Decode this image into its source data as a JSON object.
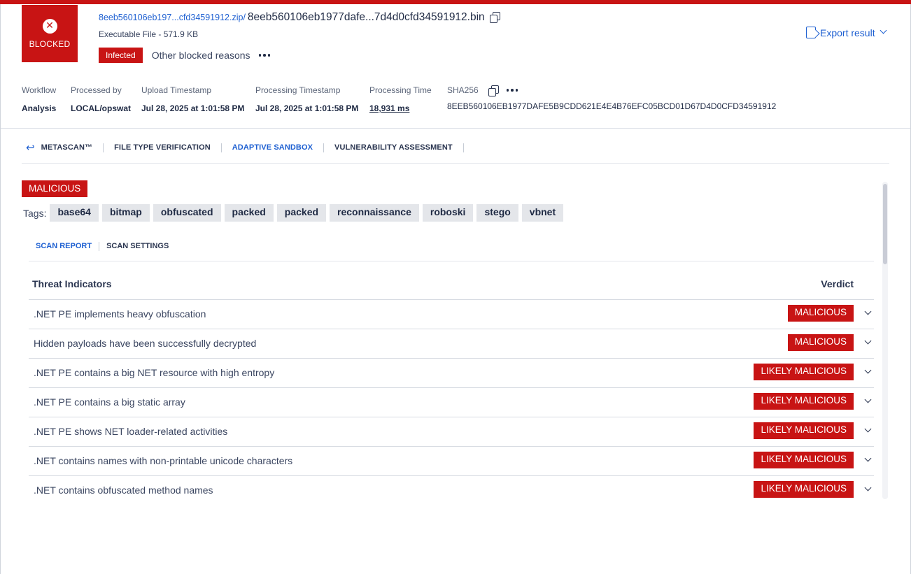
{
  "header": {
    "blocked_label": "BLOCKED",
    "zip_name": "8eeb560106eb197...cfd34591912.zip/",
    "file_name": "8eeb560106eb1977dafe...7d4d0cfd34591912.bin",
    "file_type": "Executable File - 571.9 KB",
    "infected_label": "Infected",
    "other_reasons": "Other blocked reasons",
    "export_label": "Export result"
  },
  "meta": {
    "workflow_k": "Workflow",
    "workflow_v": "Analysis",
    "processed_k": "Processed by",
    "processed_v": "LOCAL/opswat",
    "upload_k": "Upload Timestamp",
    "upload_v": "Jul 28, 2025 at 1:01:58 PM",
    "proc_ts_k": "Processing Timestamp",
    "proc_ts_v": "Jul 28, 2025 at 1:01:58 PM",
    "proc_time_k": "Processing Time",
    "proc_time_v": "18,931 ms",
    "sha_k": "SHA256",
    "sha_v": "8EEB560106EB1977DAFE5B9CDD621E4E4B76EFC05BCD01D67D4D0CFD34591912"
  },
  "engine_tabs": [
    "METASCAN™",
    "FILE TYPE VERIFICATION",
    "ADAPTIVE SANDBOX",
    "VULNERABILITY ASSESSMENT"
  ],
  "panel": {
    "verdict_badge": "MALICIOUS",
    "tags_label": "Tags:",
    "tags": [
      "base64",
      "bitmap",
      "obfuscated",
      "packed",
      "packed",
      "reconnaissance",
      "roboski",
      "stego",
      "vbnet"
    ],
    "subtabs": [
      "SCAN REPORT",
      "SCAN SETTINGS"
    ],
    "col_indicators": "Threat Indicators",
    "col_verdict": "Verdict",
    "rows": [
      {
        "desc": ".NET PE implements heavy obfuscation",
        "verdict": "MALICIOUS"
      },
      {
        "desc": "Hidden payloads have been successfully decrypted",
        "verdict": "MALICIOUS"
      },
      {
        "desc": ".NET PE contains a big NET resource with high entropy",
        "verdict": "LIKELY MALICIOUS"
      },
      {
        "desc": ".NET PE contains a big static array",
        "verdict": "LIKELY MALICIOUS"
      },
      {
        "desc": ".NET PE shows NET loader-related activities",
        "verdict": "LIKELY MALICIOUS"
      },
      {
        "desc": ".NET contains names with non-printable unicode characters",
        "verdict": "LIKELY MALICIOUS"
      },
      {
        "desc": ".NET contains obfuscated method names",
        "verdict": "LIKELY MALICIOUS"
      }
    ]
  },
  "colors": {
    "accent_red": "#c81414",
    "link_blue": "#1d5fd1",
    "tag_bg": "#e4e6ea"
  }
}
